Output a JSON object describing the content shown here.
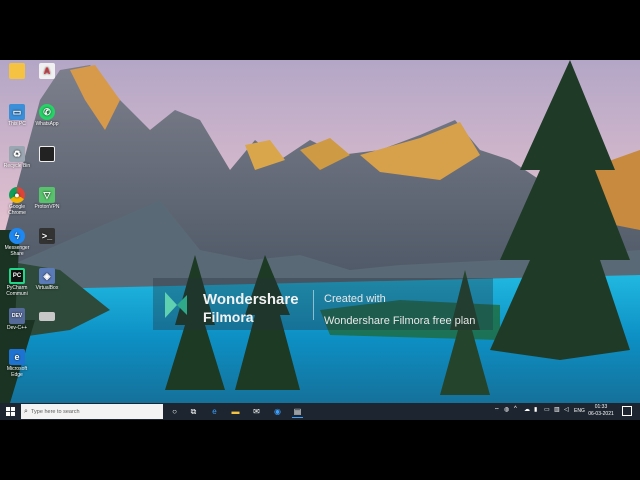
{
  "desktop": {
    "icons": [
      {
        "label": "",
        "icon": "folder-icon",
        "color": "#f5c242"
      },
      {
        "label": "",
        "icon": "adobe-acrobat-icon",
        "color": "#d8303a"
      },
      {
        "label": "This PC",
        "icon": "this-pc-icon",
        "color": "#3b8ed8"
      },
      {
        "label": "WhatsApp",
        "icon": "whatsapp-icon",
        "color": "#25d366"
      },
      {
        "label": "Recycle Bin",
        "icon": "recycle-bin-icon",
        "color": "#9aa6b2"
      },
      {
        "label": "",
        "icon": "black-window-icon",
        "color": "#222222"
      },
      {
        "label": "Google Chrome",
        "icon": "chrome-icon",
        "color": "#db4437"
      },
      {
        "label": "ProtonVPN",
        "icon": "protonvpn-icon",
        "color": "#57c26b"
      },
      {
        "label": "Messenger Share",
        "icon": "messenger-icon",
        "color": "#1e88f2"
      },
      {
        "label": "",
        "icon": "command-prompt-icon",
        "color": "#333333"
      },
      {
        "label": "PyCharm Communi",
        "icon": "pycharm-icon",
        "color": "#21d789"
      },
      {
        "label": "VirtualBox",
        "icon": "virtualbox-icon",
        "color": "#5b7bb8"
      },
      {
        "label": "Dev-C++",
        "icon": "dev-cpp-icon",
        "color": "#556a99"
      },
      {
        "label": "",
        "icon": "blank-file-icon",
        "color": "#c8c8c8"
      },
      {
        "label": "Microsoft Edge",
        "icon": "edge-icon",
        "color": "#1e73d2"
      }
    ]
  },
  "watermark": {
    "brand_line1": "Wondershare",
    "brand_line2": "Filmora",
    "created_with": "Created with",
    "plan": "Wondershare Filmora free plan"
  },
  "taskbar": {
    "search_placeholder": "Type here to search",
    "pinned": [
      "cortana-icon",
      "task-view-icon",
      "edge-icon",
      "file-explorer-icon",
      "mail-icon",
      "chrome-icon",
      "notepad-icon"
    ],
    "tray_language": "ENG",
    "time": "01:33",
    "date": "06-03-2021"
  },
  "colors": {
    "taskbar": "#1d2630",
    "accent": "#1e88f2"
  }
}
